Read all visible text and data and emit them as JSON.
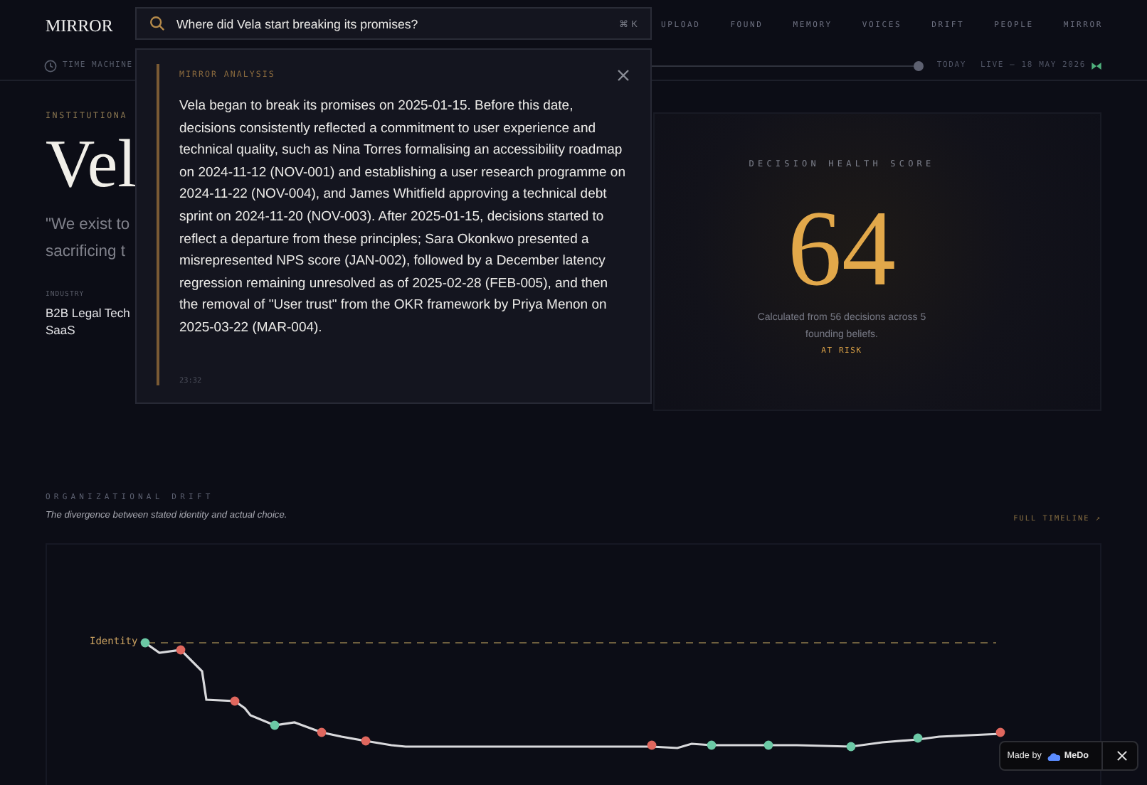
{
  "brand": "MIRROR",
  "search": {
    "value": "Where did Vela start breaking its promises?",
    "shortcut": "⌘ K"
  },
  "nav": [
    "UPLOAD",
    "FOUND",
    "MEMORY",
    "VOICES",
    "DRIFT",
    "PEOPLE",
    "MIRROR"
  ],
  "time_machine": {
    "label": "TIME MACHINE",
    "level": 1,
    "marker": "TODAY",
    "live": "LIVE — 18 MAY 2026"
  },
  "analysis": {
    "title": "MIRROR ANALYSIS",
    "text": "Vela began to break its promises on 2025-01-15. Before this date, decisions consistently reflected a commitment to user experience and technical quality, such as Nina Torres formalising an accessibility roadmap on 2024-11-12 (NOV-001) and establishing a user research programme on 2024-11-22 (NOV-004), and James Whitfield approving a technical debt sprint on 2024-11-20 (NOV-003). After 2025-01-15, decisions started to reflect a departure from these principles; Sara Okonkwo presented a misrepresented NPS score (JAN-002), followed by a December latency regression remaining unresolved as of 2025-02-28 (FEB-005), and then the removal of \"User trust\" from the OKR framework by Priya Menon on 2025-03-22 (MAR-004).",
    "time": "23:32"
  },
  "profile": {
    "eyebrow": "INSTITUTIONA",
    "name": "Vel",
    "quote_lines": [
      "\"We exist to",
      "sacrificing t"
    ],
    "industry_label": "INDUSTRY",
    "industry": "B2B Legal Tech SaaS"
  },
  "score": {
    "label": "DECISION HEALTH SCORE",
    "value": "64",
    "caption": "Calculated from 56 decisions across 5 founding beliefs.",
    "status": "AT RISK"
  },
  "drift": {
    "title": "ORGANIZATIONAL DRIFT",
    "subtitle": "The divergence between stated identity and actual choice.",
    "link": "FULL TIMELINE ↗",
    "identity_label": "Identity"
  },
  "badge": {
    "made_by": "Made by",
    "brand": "MeDo"
  }
}
